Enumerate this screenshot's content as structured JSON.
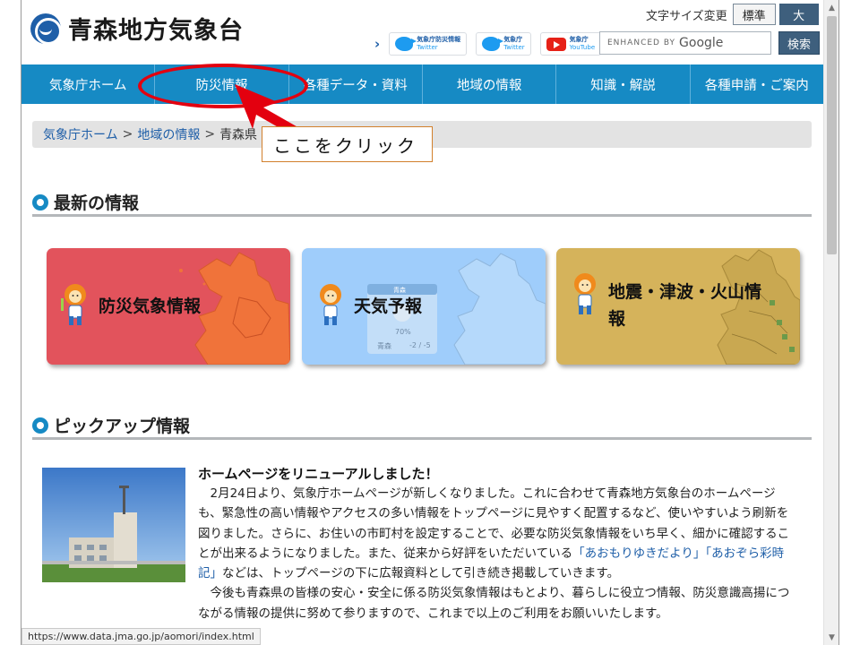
{
  "header": {
    "site_title": "青森地方気象台",
    "font_size_label": "文字サイズ変更",
    "font_standard": "標準",
    "font_large": "大",
    "sns": [
      {
        "icon": "twitter-icon",
        "line1": "気象庁防災情報",
        "line2": "Twitter"
      },
      {
        "icon": "twitter-icon",
        "line1": "気象庁",
        "line2": "Twitter"
      },
      {
        "icon": "youtube-icon",
        "line1": "気象庁",
        "line2": "YouTube"
      }
    ],
    "search_placeholder": "ENHANCED BY",
    "search_google": "Google",
    "search_button": "検索"
  },
  "nav": [
    "気象庁ホーム",
    "防災情報",
    "各種データ・資料",
    "地域の情報",
    "知識・解説",
    "各種申請・ご案内"
  ],
  "breadcrumb": {
    "items": [
      "気象庁ホーム",
      "地域の情報"
    ],
    "current": "青森県"
  },
  "annotation": {
    "text": "ここをクリック"
  },
  "sections": {
    "latest": "最新の情報",
    "pickup": "ピックアップ情報"
  },
  "cards": [
    {
      "label": "防災気象情報",
      "color": "#e2535c"
    },
    {
      "label": "天気予報",
      "color": "#9fcdfb"
    },
    {
      "label": "地震・津波・火山情報",
      "label_line1": "地震・津波・火山情",
      "label_line2": "報",
      "color": "#d5b35b"
    }
  ],
  "weather_widget": {
    "place": "青森",
    "pop": "70%",
    "temp": "-2 / -5",
    "city_top": "青森"
  },
  "news": {
    "title": "ホームページをリニューアルしました！",
    "p1_a": "2月24日より、気象庁ホームページが新しくなりました。これに合わせて青森地方気象台のホームページも、緊急性の高い情報やアクセスの多い情報をトップページに見やすく配置するなど、使いやすいよう刷新を図りました。さらに、お住いの市町村を設定することで、必要な防災気象情報をいち早く、細かに確認することが出来るようになりました。また、従来から好評をいただいている",
    "link1": "「あおもりゆきだより」",
    "link2": "「あおぞら彩時記」",
    "p1_b": "などは、トップページの下に広報資料として引き続き掲載していきます。",
    "p2": "今後も青森県の皆様の安心・安全に係る防災気象情報はもとより、暮らしに役立つ情報、防災意識高揚につながる情報の提供に努めて参りますので、これまで以上のご利用をお願いいたします。"
  },
  "status_url": "https://www.data.jma.go.jp/aomori/index.html"
}
